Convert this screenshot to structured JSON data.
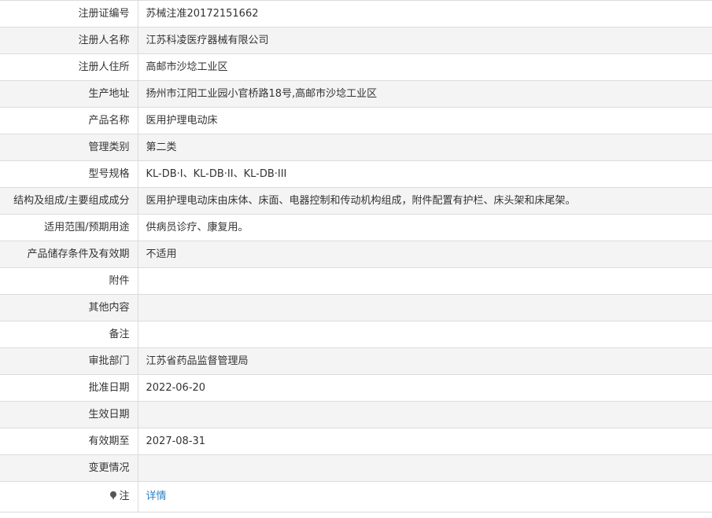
{
  "rows": [
    {
      "label": "注册证编号",
      "value": "苏械注准20172151662"
    },
    {
      "label": "注册人名称",
      "value": "江苏科凌医疗器械有限公司"
    },
    {
      "label": "注册人住所",
      "value": "高邮市沙埝工业区"
    },
    {
      "label": "生产地址",
      "value": "扬州市江阳工业园小官桥路18号,高邮市沙埝工业区"
    },
    {
      "label": "产品名称",
      "value": "医用护理电动床"
    },
    {
      "label": "管理类别",
      "value": "第二类"
    },
    {
      "label": "型号规格",
      "value": "KL-DB·I、KL-DB·II、KL-DB·III"
    },
    {
      "label": "结构及组成/主要组成成分",
      "value": "医用护理电动床由床体、床面、电器控制和传动机构组成，附件配置有护栏、床头架和床尾架。"
    },
    {
      "label": "适用范围/预期用途",
      "value": "供病员诊疗、康复用。"
    },
    {
      "label": "产品储存条件及有效期",
      "value": "不适用"
    },
    {
      "label": "附件",
      "value": ""
    },
    {
      "label": "其他内容",
      "value": ""
    },
    {
      "label": "备注",
      "value": ""
    },
    {
      "label": "审批部门",
      "value": "江苏省药品监督管理局"
    },
    {
      "label": "批准日期",
      "value": "2022-06-20"
    },
    {
      "label": "生效日期",
      "value": ""
    },
    {
      "label": "有效期至",
      "value": "2027-08-31"
    },
    {
      "label": "变更情况",
      "value": ""
    }
  ],
  "note": {
    "icon": "pin-icon",
    "label": "注",
    "link_text": "详情",
    "link_color": "#2b7fc3"
  }
}
